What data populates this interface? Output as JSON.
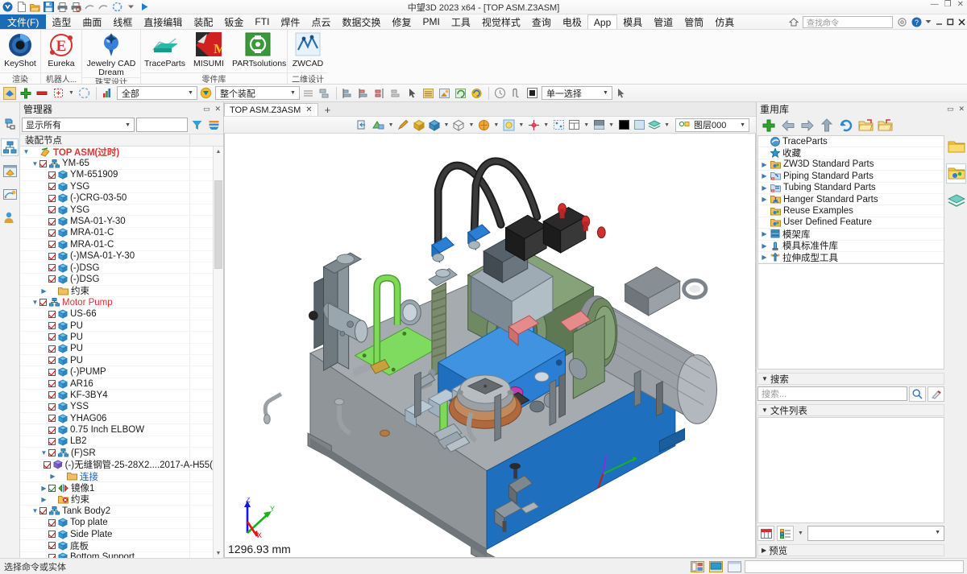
{
  "window": {
    "title": "中望3D 2023 x64 - [TOP ASM.Z3ASM]",
    "minimize": "—",
    "restore": "❐",
    "close": "✕"
  },
  "quick_access": {
    "items": [
      {
        "name": "app-logo-icon",
        "glyph": "logo"
      },
      {
        "name": "new-file-icon",
        "glyph": "new"
      },
      {
        "name": "open-file-icon",
        "glyph": "open"
      },
      {
        "name": "save-file-icon",
        "glyph": "save"
      },
      {
        "name": "print-icon",
        "glyph": "print"
      },
      {
        "name": "print-preview-icon",
        "glyph": "printprev"
      },
      {
        "name": "undo-icon",
        "glyph": "undo"
      },
      {
        "name": "redo-icon",
        "glyph": "redo"
      },
      {
        "name": "regen-icon",
        "glyph": "regen"
      },
      {
        "name": "qat-dropdown-icon",
        "glyph": "caret"
      },
      {
        "name": "run-icon",
        "glyph": "play"
      }
    ]
  },
  "menubar": {
    "file_label": "文件(F)",
    "items": [
      "造型",
      "曲面",
      "线框",
      "直接编辑",
      "装配",
      "钣金",
      "FTI",
      "焊件",
      "点云",
      "数据交换",
      "修复",
      "PMI",
      "工具",
      "视觉样式",
      "查询",
      "电极",
      "App",
      "模具",
      "管道",
      "管筒",
      "仿真"
    ],
    "active_tab": "App",
    "search_placeholder": "查找命令",
    "right_icons": [
      "home-icon",
      "settings-gear-icon",
      "help-icon",
      "help-dropdown-icon",
      "minimize-icon",
      "restore-icon",
      "close-icon"
    ]
  },
  "ribbon": {
    "groups": [
      {
        "label": "渲染",
        "buttons": [
          {
            "label": "KeyShot",
            "icon": "keyshot-icon"
          }
        ]
      },
      {
        "label": "机器人...",
        "buttons": [
          {
            "label": "Eureka",
            "icon": "eureka-icon"
          }
        ]
      },
      {
        "label": "珠宝设计",
        "buttons": [
          {
            "label": "Jewelry CAD Dream",
            "icon": "jewelry-cad-dream-icon"
          }
        ]
      },
      {
        "label": "零件库",
        "buttons": [
          {
            "label": "TraceParts",
            "icon": "traceparts-icon"
          },
          {
            "label": "MISUMI",
            "icon": "misumi-icon"
          },
          {
            "label": "PARTsolutions",
            "icon": "partsolutions-icon"
          }
        ]
      },
      {
        "label": "二维设计",
        "buttons": [
          {
            "label": "ZWCAD",
            "icon": "zwcad-icon"
          }
        ]
      }
    ]
  },
  "toolbar2": {
    "icons_left": [
      "insert-component-icon",
      "add-icon",
      "remove-icon",
      "edit-component-icon",
      "component-dropdown-icon",
      "pattern-icon",
      "color-filter-icon"
    ],
    "display_combo": "全部",
    "scope_combo": "整个装配",
    "icons_mid": [
      "align-icon",
      "align2-icon",
      "constraint-icon",
      "constraint2-icon",
      "constraint3-icon",
      "constraint4-icon",
      "pick-icon",
      "list-icon",
      "export-icon",
      "refresh-asm-icon",
      "sync-icon"
    ],
    "icons_right": [
      "clock-icon",
      "interference-icon",
      "section-icon"
    ],
    "select_mode": "单一选择",
    "cursor_icon": "cursor-icon"
  },
  "manager_panel": {
    "title": "管理器",
    "filter_combo": "显示所有",
    "filter_input": "",
    "filter_icon": "funnel-icon",
    "settings_icon": "tree-settings-icon",
    "tree_header": "装配节点",
    "collapse_icon": "collapse-panel-icon",
    "close_icon": "close-panel-icon",
    "tree": [
      {
        "depth": 0,
        "expander": "v",
        "checkbox": "none",
        "icon": "assembly-root-icon",
        "label": "TOP ASM(过时)",
        "style": "red-bold"
      },
      {
        "depth": 1,
        "expander": "v",
        "checkbox": "checked",
        "icon": "subassembly-icon",
        "label": "YM-65",
        "style": "normal"
      },
      {
        "depth": 2,
        "expander": "",
        "checkbox": "checked",
        "icon": "part-icon",
        "label": "YM-651909",
        "style": "normal"
      },
      {
        "depth": 2,
        "expander": "",
        "checkbox": "checked",
        "icon": "part-icon",
        "label": "YSG",
        "style": "normal"
      },
      {
        "depth": 2,
        "expander": "",
        "checkbox": "checked",
        "icon": "part-icon",
        "label": "(-)CRG-03-50",
        "style": "normal"
      },
      {
        "depth": 2,
        "expander": "",
        "checkbox": "checked",
        "icon": "part-icon",
        "label": "YSG",
        "style": "normal"
      },
      {
        "depth": 2,
        "expander": "",
        "checkbox": "checked",
        "icon": "part-icon",
        "label": "MSA-01-Y-30",
        "style": "normal"
      },
      {
        "depth": 2,
        "expander": "",
        "checkbox": "checked",
        "icon": "part-icon",
        "label": "MRA-01-C",
        "style": "normal"
      },
      {
        "depth": 2,
        "expander": "",
        "checkbox": "checked",
        "icon": "part-icon",
        "label": "MRA-01-C",
        "style": "normal"
      },
      {
        "depth": 2,
        "expander": "",
        "checkbox": "checked",
        "icon": "part-icon",
        "label": "(-)MSA-01-Y-30",
        "style": "normal"
      },
      {
        "depth": 2,
        "expander": "",
        "checkbox": "checked",
        "icon": "part-icon",
        "label": "(-)DSG",
        "style": "normal"
      },
      {
        "depth": 2,
        "expander": "",
        "checkbox": "checked",
        "icon": "part-icon",
        "label": "(-)DSG",
        "style": "normal"
      },
      {
        "depth": 2,
        "expander": ">",
        "checkbox": "none",
        "icon": "folder-icon",
        "label": "约束",
        "style": "normal"
      },
      {
        "depth": 1,
        "expander": "v",
        "checkbox": "checked",
        "icon": "subassembly-icon",
        "label": "Motor Pump",
        "style": "red"
      },
      {
        "depth": 2,
        "expander": "",
        "checkbox": "checked",
        "icon": "part-icon",
        "label": "US-66",
        "style": "normal"
      },
      {
        "depth": 2,
        "expander": "",
        "checkbox": "checked",
        "icon": "part-icon",
        "label": "PU",
        "style": "normal"
      },
      {
        "depth": 2,
        "expander": "",
        "checkbox": "checked",
        "icon": "part-icon",
        "label": "PU",
        "style": "normal"
      },
      {
        "depth": 2,
        "expander": "",
        "checkbox": "checked",
        "icon": "part-icon",
        "label": "PU",
        "style": "normal"
      },
      {
        "depth": 2,
        "expander": "",
        "checkbox": "checked",
        "icon": "part-icon",
        "label": "PU",
        "style": "normal"
      },
      {
        "depth": 2,
        "expander": "",
        "checkbox": "checked",
        "icon": "part-icon",
        "label": "(-)PUMP",
        "style": "normal"
      },
      {
        "depth": 2,
        "expander": "",
        "checkbox": "checked",
        "icon": "part-icon",
        "label": "AR16",
        "style": "normal"
      },
      {
        "depth": 2,
        "expander": "",
        "checkbox": "checked",
        "icon": "part-icon",
        "label": "KF-3BY4",
        "style": "normal"
      },
      {
        "depth": 2,
        "expander": "",
        "checkbox": "checked",
        "icon": "part-icon",
        "label": "YSS",
        "style": "normal"
      },
      {
        "depth": 2,
        "expander": "",
        "checkbox": "checked",
        "icon": "part-icon",
        "label": "YHAG06",
        "style": "normal"
      },
      {
        "depth": 2,
        "expander": "",
        "checkbox": "checked",
        "icon": "part-icon",
        "label": "0.75 Inch ELBOW",
        "style": "normal"
      },
      {
        "depth": 2,
        "expander": "",
        "checkbox": "checked",
        "icon": "part-icon",
        "label": "LB2",
        "style": "normal"
      },
      {
        "depth": 2,
        "expander": "v",
        "checkbox": "checked",
        "icon": "subassembly-icon",
        "label": "(F)SR",
        "style": "normal"
      },
      {
        "depth": 3,
        "expander": "",
        "checkbox": "checked",
        "icon": "pipe-part-icon",
        "label": "(-)无缝钢管-25-28X2....2017-A-H55(",
        "style": "normal"
      },
      {
        "depth": 3,
        "expander": ">",
        "checkbox": "none",
        "icon": "folder-icon",
        "label": "连接",
        "style": "blue"
      },
      {
        "depth": 2,
        "expander": ">",
        "checkbox": "green",
        "icon": "mirror-icon",
        "label": "镜像1",
        "style": "normal"
      },
      {
        "depth": 2,
        "expander": ">",
        "checkbox": "none",
        "icon": "folder-error-icon",
        "label": "约束",
        "style": "normal"
      },
      {
        "depth": 1,
        "expander": "v",
        "checkbox": "checked",
        "icon": "subassembly-icon",
        "label": "Tank Body2",
        "style": "normal"
      },
      {
        "depth": 2,
        "expander": "",
        "checkbox": "checked",
        "icon": "part-icon",
        "label": "Top plate",
        "style": "normal"
      },
      {
        "depth": 2,
        "expander": "",
        "checkbox": "checked",
        "icon": "part-icon",
        "label": "Side Plate",
        "style": "normal"
      },
      {
        "depth": 2,
        "expander": "",
        "checkbox": "checked",
        "icon": "part-icon",
        "label": "底板",
        "style": "normal"
      },
      {
        "depth": 2,
        "expander": "",
        "checkbox": "checked",
        "icon": "part-icon",
        "label": "Bottom Support",
        "style": "normal"
      }
    ]
  },
  "left_strip": {
    "icons": [
      {
        "name": "history-manager-icon",
        "selected": false
      },
      {
        "name": "assembly-manager-icon",
        "selected": true
      },
      {
        "name": "part-manager-icon",
        "selected": false
      },
      {
        "name": "animation-manager-icon",
        "selected": false
      },
      {
        "name": "user-manager-icon",
        "selected": false
      }
    ]
  },
  "document_tab": {
    "label": "TOP ASM.Z3ASM",
    "close_glyph": "✕",
    "new_tab_glyph": "+"
  },
  "view_toolbar": {
    "icons": [
      "exit-icon",
      "visual-style-icon",
      "vs-dropdown",
      "sketch-icon",
      "shaded-icon",
      "shaded-edge-icon",
      "se-dropdown",
      "wireframe-icon",
      "wf-dropdown",
      "render-icon",
      "rd-dropdown",
      "light-icon",
      "lt-dropdown",
      "axis-icon",
      "ax-dropdown",
      "grid-icon",
      "view-mgr-icon",
      "vm-dropdown",
      "bg-color-icon",
      "bg-dropdown",
      "black-swatch",
      "light-swatch",
      "layer-stack-icon",
      "ls-dropdown"
    ],
    "layer_visible_icon": "layer-bulb-icon",
    "layer_name": "图层000"
  },
  "viewport": {
    "scale_label": "1296.93 mm",
    "background": "#ffffff",
    "axes": {
      "z": "Z",
      "y": "Y",
      "x": "X",
      "z_color": "#1414e6",
      "y_color": "#14b414",
      "x_color": "#e61414"
    },
    "model_colors": {
      "tank_front": "#1f6fbf",
      "tank_side": "#8e9398",
      "tank_top": "#a8adb1",
      "motor": "#9aa0a6",
      "manifold_blue": "#2a7fd4",
      "pump_green": "#6f8a63",
      "hose_green": "#7ed957",
      "base_plate": "#7fdb5f",
      "fitting_red": "#e06c6c",
      "hose_black": "#2b2b2b",
      "valve_grey": "#b9c4cc",
      "copper": "#c08a5e"
    }
  },
  "reuse_library": {
    "title": "重用库",
    "collapse_icon": "collapse-panel-icon",
    "close_icon": "close-panel-icon",
    "toolbar": [
      "add-library-icon",
      "back-icon",
      "forward-icon",
      "up-icon",
      "refresh-icon",
      "open-folder-icon",
      "new-folder-icon"
    ],
    "items": [
      {
        "expander": "",
        "icon": "traceparts-logo-icon",
        "label": "TraceParts"
      },
      {
        "expander": "",
        "icon": "favorite-star-icon",
        "label": "收藏"
      },
      {
        "expander": ">",
        "icon": "library-folder-icon",
        "label": "ZW3D Standard Parts"
      },
      {
        "expander": ">",
        "icon": "piping-library-icon",
        "label": "Piping Standard Parts"
      },
      {
        "expander": ">",
        "icon": "tubing-library-icon",
        "label": "Tubing Standard Parts"
      },
      {
        "expander": ">",
        "icon": "hanger-library-icon",
        "label": "Hanger Standard Parts"
      },
      {
        "expander": "",
        "icon": "library-folder-icon",
        "label": "Reuse Examples"
      },
      {
        "expander": "",
        "icon": "library-folder-icon",
        "label": "User Defined Feature"
      },
      {
        "expander": ">",
        "icon": "mold-base-icon",
        "label": "模架库"
      },
      {
        "expander": ">",
        "icon": "mold-standard-icon",
        "label": "模具标准件库"
      },
      {
        "expander": ">",
        "icon": "stretch-forming-icon",
        "label": "拉伸成型工具"
      }
    ],
    "side_tabs": [
      {
        "name": "folder-tab-icon",
        "selected": false
      },
      {
        "name": "reuse-library-tab-icon",
        "selected": true
      },
      {
        "name": "layers-tab-icon",
        "selected": false
      }
    ],
    "search_section": "搜索",
    "search_placeholder": "搜索...",
    "search_button_icon": "search-magnifier-icon",
    "clear_search_icon": "clear-search-icon",
    "filelist_section": "文件列表",
    "view_icons": [
      "thumbnail-view-icon",
      "detail-view-icon",
      "view-dropdown-icon"
    ],
    "path_combo": "",
    "preview_section": "预览"
  },
  "statusbar": {
    "message": "选择命令或实体",
    "icons": [
      "layout-view-icon",
      "display-view-icon",
      "window-view-icon"
    ],
    "field_value": ""
  }
}
